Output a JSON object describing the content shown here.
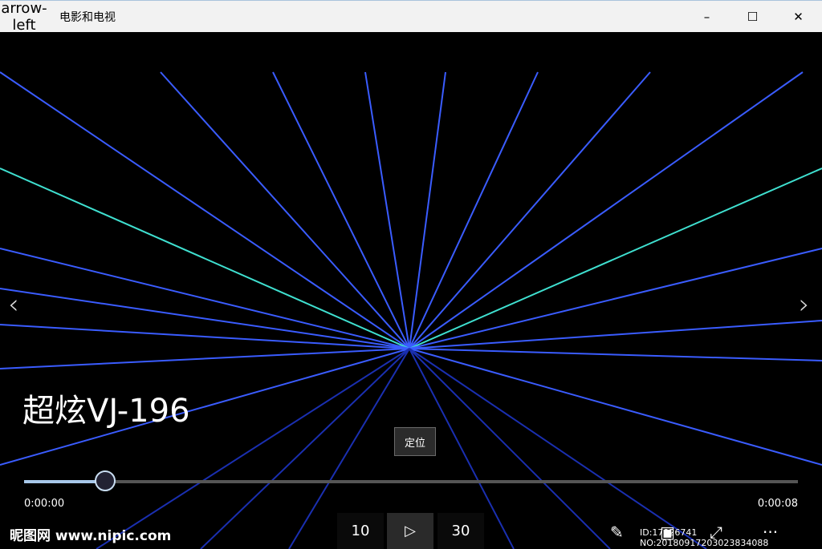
{
  "titlebar": {
    "back_icon": "arrow-left",
    "title": "电影和电视",
    "minimize": "–",
    "maximize": "☐",
    "close": "✕"
  },
  "video": {
    "title": "超炫VJ-196",
    "tooltip": "定位",
    "current_time": "0:00:00",
    "duration": "0:00:08",
    "progress": 0.105
  },
  "controls": {
    "rewind": "10",
    "forward": "30",
    "play": "▷",
    "pen": "✎",
    "miniview": "▣",
    "fullscreen": "⤢",
    "more": "···"
  },
  "watermark": {
    "brand": "昵图网 www.nipic.com",
    "id": "ID:17926741 NO:20180917203023834088"
  },
  "nav": {
    "prev": "‹",
    "next": "›"
  }
}
